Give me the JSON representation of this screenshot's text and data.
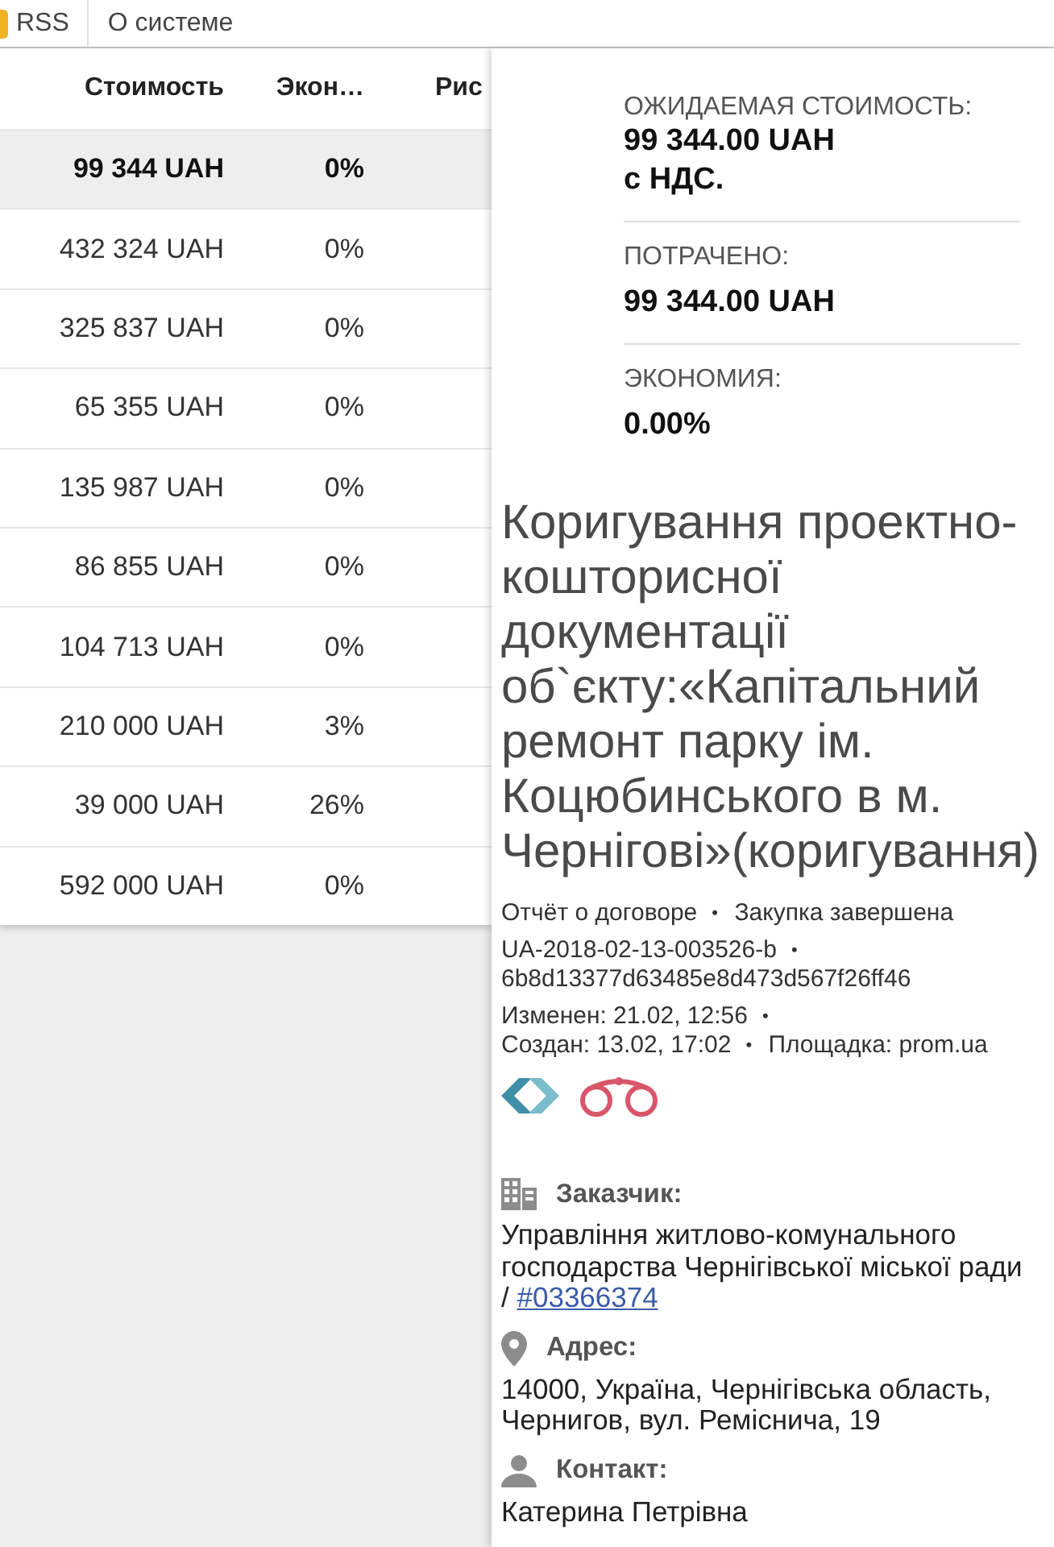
{
  "nav": {
    "items": [
      {
        "label": "RSS"
      },
      {
        "label": "О системе"
      }
    ]
  },
  "table": {
    "columns": [
      {
        "label": "Стоимость"
      },
      {
        "label": "Экон…"
      },
      {
        "label": "Рис"
      }
    ],
    "rows": [
      {
        "cost": "99 344 UAH",
        "economy": "0%",
        "selected": true
      },
      {
        "cost": "432 324 UAH",
        "economy": "0%",
        "selected": false
      },
      {
        "cost": "325 837 UAH",
        "economy": "0%",
        "selected": false
      },
      {
        "cost": "65 355 UAH",
        "economy": "0%",
        "selected": false
      },
      {
        "cost": "135 987 UAH",
        "economy": "0%",
        "selected": false
      },
      {
        "cost": "86 855 UAH",
        "economy": "0%",
        "selected": false
      },
      {
        "cost": "104 713 UAH",
        "economy": "0%",
        "selected": false
      },
      {
        "cost": "210 000 UAH",
        "economy": "3%",
        "selected": false
      },
      {
        "cost": "39 000 UAH",
        "economy": "26%",
        "selected": false
      },
      {
        "cost": "592 000 UAH",
        "economy": "0%",
        "selected": false
      }
    ]
  },
  "details": {
    "stats": [
      {
        "label": "ОЖИДАЕМАЯ СТОИМОСТЬ:",
        "value": "99 344.00 UAH",
        "note": "с НДС."
      },
      {
        "label": "ПОТРАЧЕНО:",
        "value": "99 344.00 UAH"
      },
      {
        "label": "ЭКОНОМИЯ:",
        "value": "0.00%"
      }
    ],
    "title": "Коригування проектно-кошторисної документації об`єкту:«Капітальний ремонт парку ім. Коцюбинського в м. Чернігові»(коригування)",
    "separator": "•",
    "meta": [
      {
        "items": [
          "Отчёт о договоре",
          "Закупка завершена"
        ]
      },
      {
        "items": [
          "UA-2018-02-13-003526-b",
          "6b8d13377d63485e8d473d567f26ff46"
        ]
      },
      {
        "items": [
          "Изменен: 21.02, 12:56",
          "Создан: 13.02, 17:02",
          "Площадка: prom.ua"
        ]
      }
    ],
    "badges": [
      {
        "kind": "chevrons"
      },
      {
        "kind": "binoculars"
      }
    ],
    "sections": [
      {
        "kind": "customer",
        "label": "Заказчик:",
        "text": "Управління житлово-комунального господарства Чернігівської міської ради /",
        "link": "#03366374"
      },
      {
        "kind": "address",
        "label": "Адрес:",
        "text": "14000, Україна, Чернігівська область, Чернигов, вул. Реміснича, 19"
      },
      {
        "kind": "contact",
        "label": "Контакт:",
        "text": "Катерина Петрівна"
      }
    ]
  }
}
